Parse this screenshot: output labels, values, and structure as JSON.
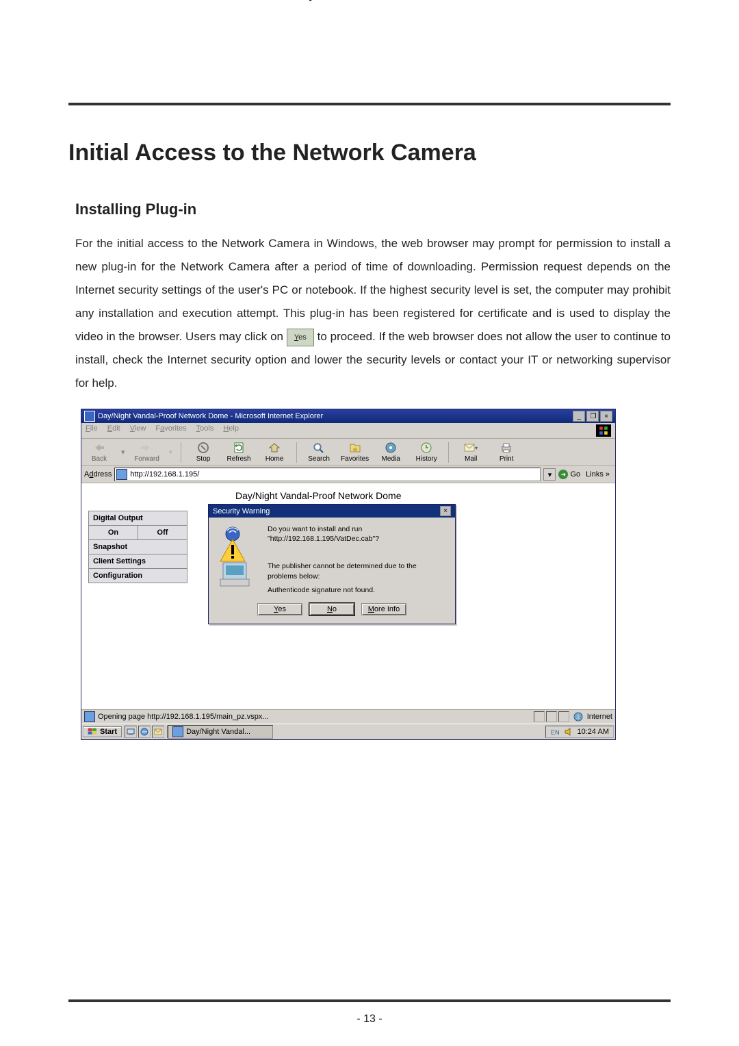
{
  "doc": {
    "heading": "Initial Access to the Network Camera",
    "subheading": "Installing Plug-in",
    "para1": "For the initial access to the Network Camera in Windows, the web browser may prompt for permission to install a new plug-in for the Network Camera after a period of time of downloading. Permission request depends on the Internet security settings of the user's PC or notebook. If the highest security level is set, the computer may prohibit any installation and execution attempt. This plug-in has been registered for certificate and is used to display the video in the browser. Users may click on ",
    "para2": " to proceed. If the web browser does not allow the user to continue to install, check the Internet security option and lower the security levels or contact your IT or networking supervisor for help.",
    "yes_chip": "Yes",
    "page_num": "- 13 -"
  },
  "ie": {
    "title": "Day/Night Vandal-Proof Network Dome - Microsoft Internet Explorer",
    "min": "_",
    "max_a": "❐",
    "close": "×",
    "menu": {
      "file": "File",
      "edit": "Edit",
      "view": "View",
      "fav": "Favorites",
      "tools": "Tools",
      "help": "Help"
    },
    "tb": {
      "back": "Back",
      "forward": "Forward",
      "stop": "Stop",
      "refresh": "Refresh",
      "home": "Home",
      "search": "Search",
      "favorites": "Favorites",
      "media": "Media",
      "history": "History",
      "mail": "Mail",
      "print": "Print"
    },
    "addr_label": "Address",
    "url": "http://192.168.1.195/",
    "go": "Go",
    "links": "Links »",
    "status_left": "Opening page http://192.168.1.195/main_pz.vspx...",
    "status_zone": "Internet"
  },
  "cam": {
    "title": "Day/Night Vandal-Proof Network Dome",
    "side": {
      "digital_output": "Digital Output",
      "on": "On",
      "off": "Off",
      "snapshot": "Snapshot",
      "client": "Client Settings",
      "config": "Configuration"
    }
  },
  "dlg": {
    "title": "Security Warning",
    "line1": "Do you want to install and run",
    "line2": "\"http://192.168.1.195/VatDec.cab\"?",
    "line3": "The publisher cannot be determined due to the problems below:",
    "line4": "Authenticode signature not found.",
    "yes": "Yes",
    "no": "No",
    "more": "More Info"
  },
  "task": {
    "start": "Start",
    "task_label": "Day/Night Vandal...",
    "time": "10:24 AM"
  }
}
